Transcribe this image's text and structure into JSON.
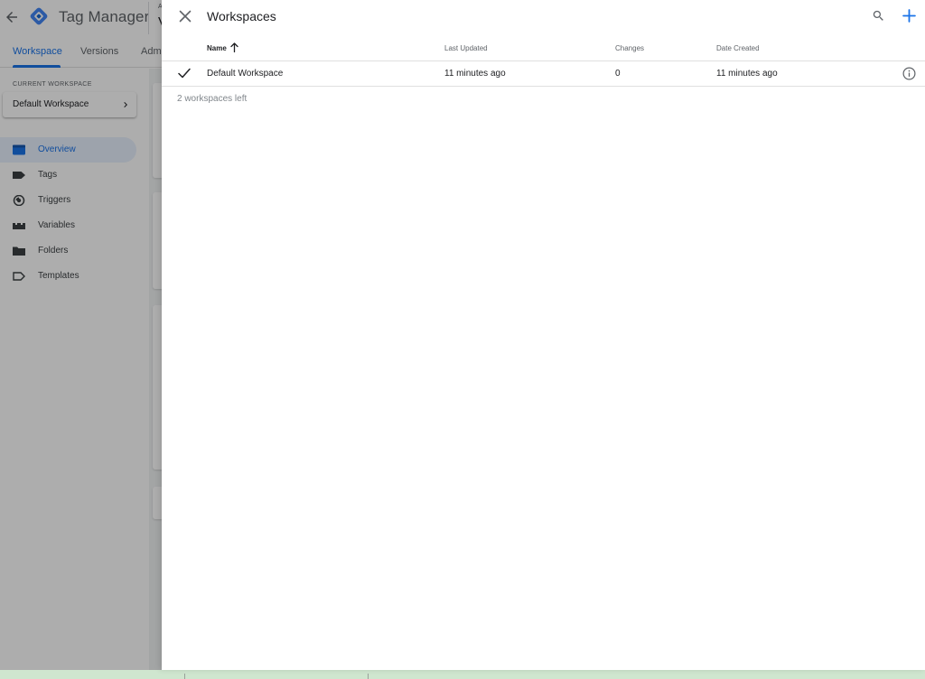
{
  "app": {
    "product_name": "Tag Manager",
    "account_label": "A",
    "account_value": "V"
  },
  "nav_tabs": [
    {
      "label": "Workspace",
      "active": true
    },
    {
      "label": "Versions",
      "active": false
    },
    {
      "label": "Admi",
      "active": false
    }
  ],
  "sidebar": {
    "current_workspace_label": "CURRENT WORKSPACE",
    "current_workspace_name": "Default Workspace",
    "items": [
      {
        "label": "Overview",
        "icon": "overview-icon",
        "active": true
      },
      {
        "label": "Tags",
        "icon": "tag-icon",
        "active": false
      },
      {
        "label": "Triggers",
        "icon": "trigger-icon",
        "active": false
      },
      {
        "label": "Variables",
        "icon": "variables-icon",
        "active": false
      },
      {
        "label": "Folders",
        "icon": "folder-icon",
        "active": false
      },
      {
        "label": "Templates",
        "icon": "template-icon",
        "active": false
      }
    ]
  },
  "panel": {
    "title": "Workspaces",
    "columns": {
      "name": "Name",
      "last_updated": "Last Updated",
      "changes": "Changes",
      "date_created": "Date Created"
    },
    "rows": [
      {
        "name": "Default Workspace",
        "last_updated": "11 minutes ago",
        "changes": "0",
        "date_created": "11 minutes ago",
        "selected": true
      }
    ],
    "workspaces_left": "2 workspaces left"
  },
  "colors": {
    "accent": "#1a73e8",
    "text": "#202124",
    "secondary_text": "#5f6368",
    "scrim": "rgba(0,0,0,0.32)"
  }
}
